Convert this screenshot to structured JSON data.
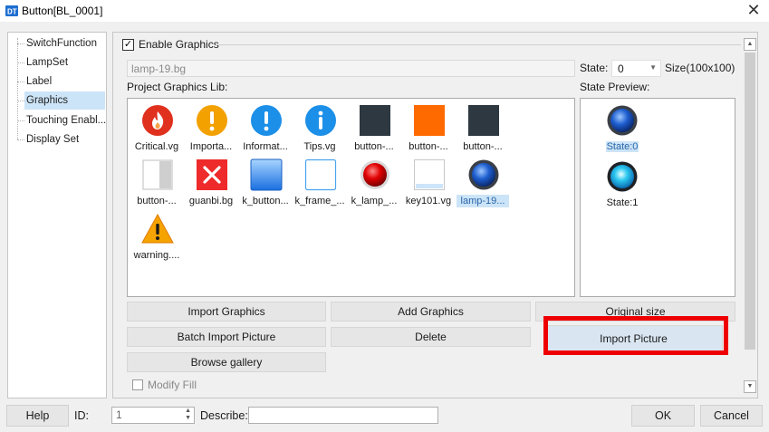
{
  "window": {
    "title": "Button[BL_0001]",
    "close_glyph": "✕",
    "app_icon": "app-icon"
  },
  "nav": {
    "items": [
      {
        "label": "SwitchFunction",
        "selected": false
      },
      {
        "label": "LampSet",
        "selected": false
      },
      {
        "label": "Label",
        "selected": false
      },
      {
        "label": "Graphics",
        "selected": true
      },
      {
        "label": "Touching Enabl...",
        "selected": false
      },
      {
        "label": "Display Set",
        "selected": false
      }
    ]
  },
  "graphics": {
    "enable_label": "Enable Graphics",
    "enable_checked": true,
    "check_glyph": "✓",
    "file_name": "lamp-19.bg",
    "state_label": "State:",
    "state_value": "0",
    "size_label": "Size(100x100)",
    "lib_label": "Project Graphics Lib:",
    "preview_label": "State Preview:",
    "library": [
      {
        "caption": "Critical.vg",
        "icon": "critical-fire-icon"
      },
      {
        "caption": "Importa...",
        "icon": "important-exclamation-icon"
      },
      {
        "caption": "Informat...",
        "icon": "information-exclamation-icon"
      },
      {
        "caption": "Tips.vg",
        "icon": "tips-info-icon"
      },
      {
        "caption": "button-...",
        "icon": "dark-square-icon"
      },
      {
        "caption": "button-...",
        "icon": "orange-square-icon"
      },
      {
        "caption": "button-...",
        "icon": "dark-square-icon"
      },
      {
        "caption": "button-...",
        "icon": "half-gray-button-icon"
      },
      {
        "caption": "guanbi.bg",
        "icon": "red-close-icon"
      },
      {
        "caption": "k_button...",
        "icon": "blue-gradient-button-icon"
      },
      {
        "caption": "k_frame_...",
        "icon": "frame-icon"
      },
      {
        "caption": "k_lamp_...",
        "icon": "red-lamp-icon"
      },
      {
        "caption": "key101.vg",
        "icon": "key-frame-icon"
      },
      {
        "caption": "lamp-19...",
        "icon": "blue-lamp-icon",
        "selected": true
      },
      {
        "caption": "warning....",
        "icon": "warning-triangle-icon"
      }
    ],
    "preview": [
      {
        "caption": "State:0",
        "icon": "blue-lamp-dark-icon",
        "selected": true
      },
      {
        "caption": "State:1",
        "icon": "blue-lamp-lit-icon",
        "selected": false
      }
    ],
    "buttons": {
      "import_graphics": "Import Graphics",
      "add_graphics": "Add Graphics",
      "original_size": "Original size",
      "batch_import": "Batch Import Picture",
      "delete": "Delete",
      "import_picture": "Import Picture",
      "browse_gallery": "Browse gallery"
    },
    "modify_fill_label": "Modify Fill",
    "modify_fill_checked": false
  },
  "footer": {
    "help": "Help",
    "id_label": "ID:",
    "id_value": "1",
    "describe_label": "Describe:",
    "describe_value": "",
    "ok": "OK",
    "cancel": "Cancel"
  },
  "colors": {
    "highlight": "#ee0000",
    "selection": "#cce4f7"
  }
}
